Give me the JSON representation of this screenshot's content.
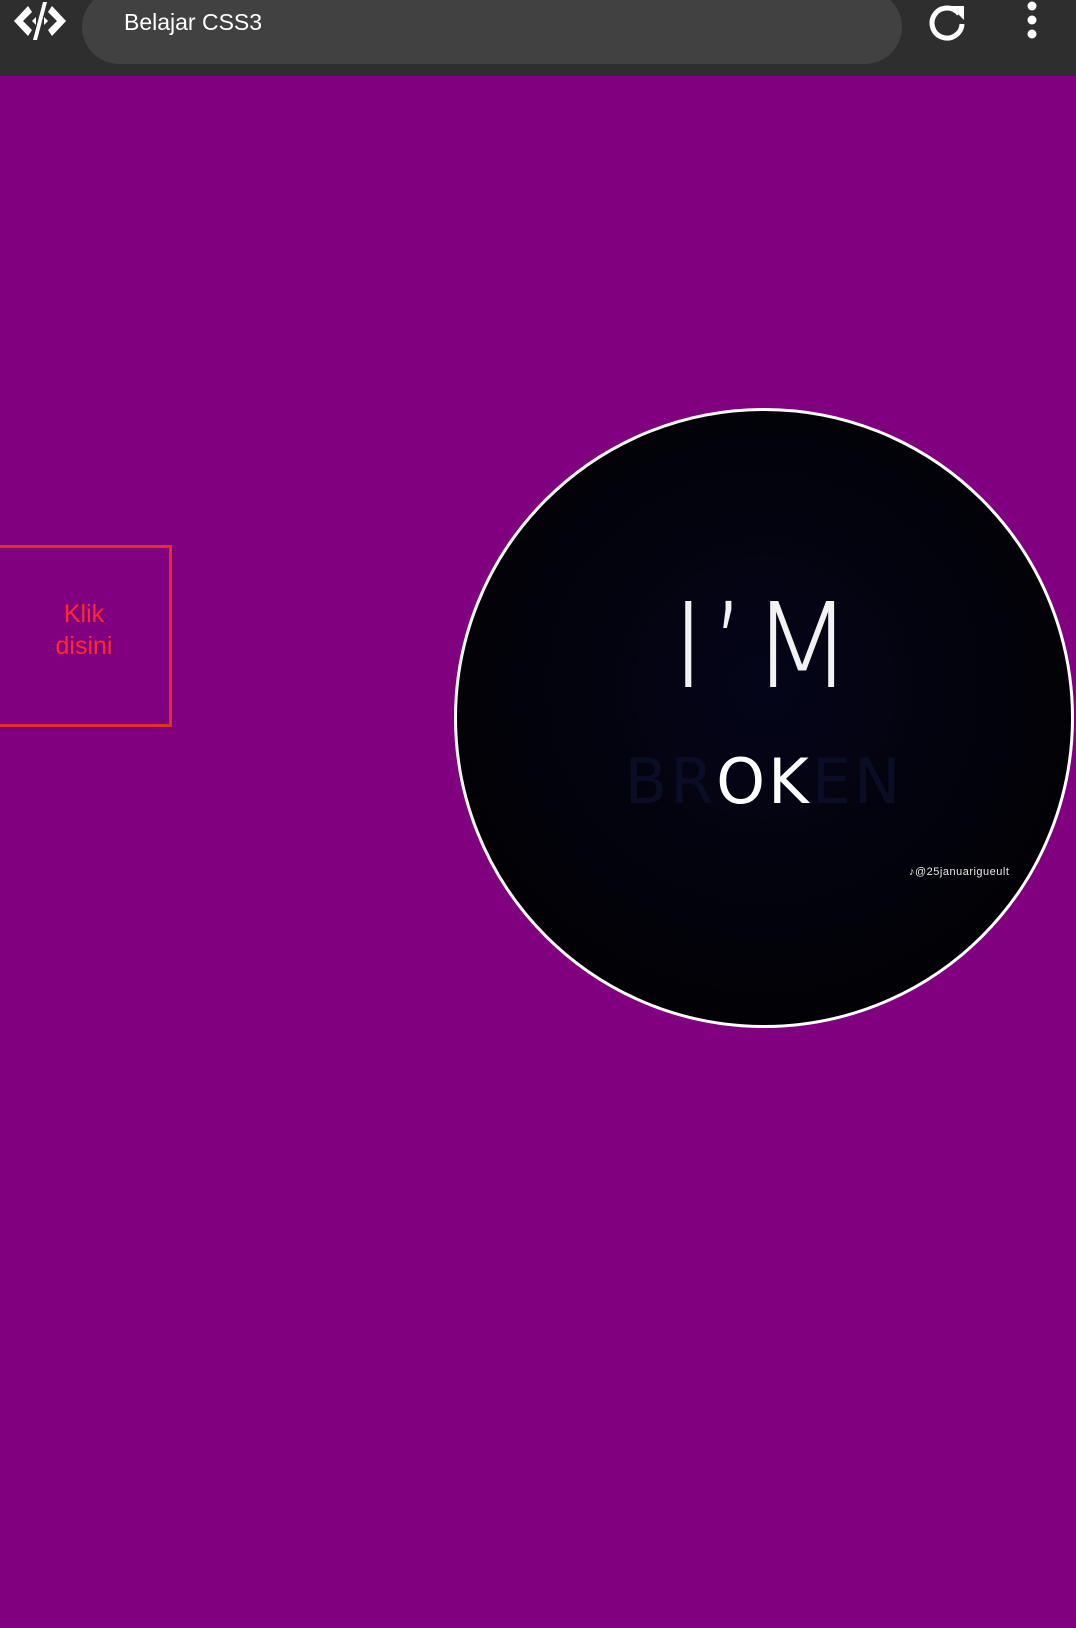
{
  "browser": {
    "url_text": "Belajar CSS3",
    "logo_icon": "code-bracket-logo-icon",
    "reload_icon": "reload-icon",
    "menu_icon": "more-vert-icon"
  },
  "page": {
    "background_color": "#800080",
    "button": {
      "label_line1": "Klik",
      "label_line2": "disini",
      "border_color": "#e0302a",
      "text_color": "#ff2a2a"
    },
    "image": {
      "line1": "I’M",
      "line2_dim_start": "BR",
      "line2_bright": "OK",
      "line2_dim_end": "EN",
      "watermark": "♪@25januarigueult",
      "border_color": "#ffffff"
    }
  }
}
